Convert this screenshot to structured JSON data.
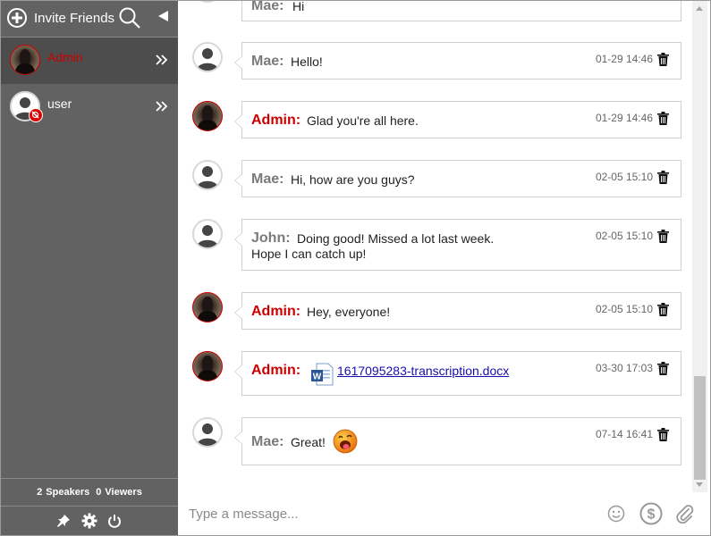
{
  "sidebar": {
    "invite_label": "Invite Friends",
    "users": [
      {
        "name": "Admin",
        "role": "admin"
      },
      {
        "name": "user",
        "role": "plain"
      }
    ],
    "stats": {
      "speakers_count": "2",
      "speakers_label": "Speakers",
      "viewers_count": "0",
      "viewers_label": "Viewers"
    }
  },
  "messages": [
    {
      "sender": "Mae:",
      "text": "Hi",
      "time": "",
      "kind": "other"
    },
    {
      "sender": "Mae:",
      "text": "Hello!",
      "time": "01-29 14:46",
      "kind": "other"
    },
    {
      "sender": "Admin:",
      "text": "Glad you're all here.",
      "time": "01-29 14:46",
      "kind": "admin"
    },
    {
      "sender": "Mae:",
      "text": "Hi, how are you guys?",
      "time": "02-05 15:10",
      "kind": "other"
    },
    {
      "sender": "John:",
      "text": "Doing good! Missed a lot last week.",
      "text2": "Hope I can catch up!",
      "time": "02-05 15:10",
      "kind": "other"
    },
    {
      "sender": "Admin:",
      "text": "Hey, everyone!",
      "time": "02-05 15:10",
      "kind": "admin"
    },
    {
      "sender": "Admin:",
      "file": " 1617095283-transcription.docx",
      "time": "03-30 17:03",
      "kind": "admin"
    },
    {
      "sender": "Mae:",
      "text": "Great!",
      "time": "07-14 16:41",
      "kind": "other"
    }
  ],
  "composer": {
    "placeholder": "Type a message..."
  },
  "colors": {
    "sidebar": "#626262",
    "admin": "#cc0000",
    "link": "#1a0dab"
  }
}
